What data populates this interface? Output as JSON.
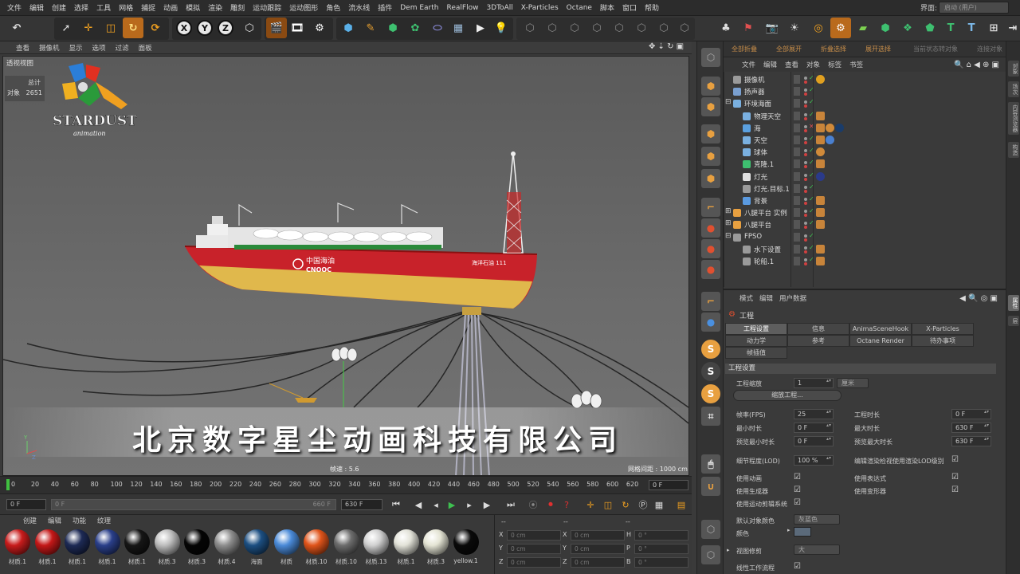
{
  "menubar": {
    "items": [
      "文件",
      "编辑",
      "创建",
      "选择",
      "工具",
      "网格",
      "捕捉",
      "动画",
      "模拟",
      "渲染",
      "雕刻",
      "运动跟踪",
      "运动图形",
      "角色",
      "流水线",
      "插件",
      "Dem Earth",
      "RealFlow",
      "3DToAll",
      "X-Particles",
      "Octane",
      "脚本",
      "窗口",
      "帮助"
    ],
    "layout_label": "界面:",
    "layout_value": "启动 (用户)"
  },
  "toolbar": {
    "xyz": [
      "X",
      "Y",
      "Z"
    ]
  },
  "viewport": {
    "menu": [
      "查看",
      "摄像机",
      "显示",
      "选项",
      "过滤",
      "面板"
    ],
    "label": "透视视图",
    "stat_title": "总计",
    "stat_obj_label": "对象",
    "stat_obj_value": "2651",
    "logo_text": "STARDUST",
    "logo_sub": "animation",
    "watermark": "北京数字星尘动画科技有限公司",
    "fps": "帧速 : 5.6",
    "grid_spacing": "网格间距 : 1000 cm",
    "ship_text_1": "中国海油",
    "ship_text_2": "CNOOC",
    "ship_text_3": "海洋石油 111"
  },
  "timeline": {
    "ticks": [
      "0",
      "20",
      "40",
      "60",
      "80",
      "100",
      "120",
      "140",
      "160",
      "180",
      "200",
      "220",
      "240",
      "260",
      "280",
      "300",
      "320",
      "340",
      "360",
      "380",
      "400",
      "420",
      "440",
      "460",
      "480",
      "500",
      "520",
      "540",
      "560",
      "580",
      "600",
      "620"
    ],
    "current_frame": "0 F"
  },
  "playbar": {
    "start": "0 F",
    "range_start": "0 F",
    "range_end": "660 F",
    "end": "630 F"
  },
  "materials": {
    "menu": [
      "创建",
      "编辑",
      "功能",
      "纹理"
    ],
    "items": [
      {
        "label": "材质.1",
        "color": "#c81c1c"
      },
      {
        "label": "材质.1",
        "color": "#c41818"
      },
      {
        "label": "材质.1",
        "color": "#1d2a55"
      },
      {
        "label": "材质.1",
        "color": "#2a3f8a"
      },
      {
        "label": "材质.1",
        "color": "#161616"
      },
      {
        "label": "材质.3",
        "color": "#bdbdbd"
      },
      {
        "label": "材质.3",
        "color": "#050505"
      },
      {
        "label": "材质.4",
        "color": "#8e8e8e"
      },
      {
        "label": "海面",
        "color": "#1c4f82"
      },
      {
        "label": "材质",
        "color": "#4a8ad8"
      },
      {
        "label": "材质.10",
        "color": "#e0541a"
      },
      {
        "label": "材质.10",
        "color": "#6d6d6d"
      },
      {
        "label": "材质.13",
        "color": "#d0d0d0"
      },
      {
        "label": "材质.1",
        "color": "#e2e2d8"
      },
      {
        "label": "材质.3",
        "color": "#e4e4d4"
      },
      {
        "label": "yellow.1",
        "color": "#0a0a0a"
      }
    ]
  },
  "coords": {
    "header": [
      "--",
      "--",
      "--"
    ],
    "rows": [
      {
        "a": "X",
        "av": "0 cm",
        "b": "X",
        "bv": "0 cm",
        "c": "H",
        "cv": "0 °"
      },
      {
        "a": "Y",
        "av": "0 cm",
        "b": "Y",
        "bv": "0 cm",
        "c": "P",
        "cv": "0 °"
      },
      {
        "a": "Z",
        "av": "0 cm",
        "b": "Z",
        "bv": "0 cm",
        "c": "B",
        "cv": "0 °"
      }
    ]
  },
  "object_manager": {
    "tabs": [
      "全部折叠",
      "全部展开",
      "折叠选择",
      "展开选择",
      "当前状态转对象",
      "连接对象"
    ],
    "menu": [
      "文件",
      "编辑",
      "查看",
      "对象",
      "标签",
      "书签"
    ],
    "rows": [
      {
        "name": "摄像机",
        "indent": 1
      },
      {
        "name": "扬声器",
        "indent": 1
      },
      {
        "name": "环境海面",
        "indent": 1
      },
      {
        "name": "物理天空",
        "indent": 2
      },
      {
        "name": "海",
        "indent": 2
      },
      {
        "name": "天空",
        "indent": 2
      },
      {
        "name": "球体",
        "indent": 2
      },
      {
        "name": "克隆.1",
        "indent": 2
      },
      {
        "name": "灯光",
        "indent": 2
      },
      {
        "name": "灯光.目标.1",
        "indent": 2
      },
      {
        "name": "背景",
        "indent": 2
      },
      {
        "name": "八腿平台 实例",
        "indent": 1
      },
      {
        "name": "八腿平台",
        "indent": 1
      },
      {
        "name": "FPSO",
        "indent": 1
      },
      {
        "name": "水下设置",
        "indent": 2
      },
      {
        "name": "轮船.1",
        "indent": 2
      }
    ]
  },
  "attributes": {
    "menu": [
      "模式",
      "编辑",
      "用户数据"
    ],
    "title": "工程",
    "tabs_row1": [
      "工程设置",
      "信息",
      "AnimaSceneHook",
      "X-Particles"
    ],
    "tabs_row2": [
      "动力学",
      "参考",
      "Octane Render",
      "待办事项"
    ],
    "tabs_row3": [
      "帧插值"
    ],
    "section": "工程设置",
    "scale_label": "工程缩放",
    "scale_value": "1",
    "scale_unit": "厘米",
    "scale_btn": "缩放工程...",
    "fps_label": "帧率(FPS)",
    "fps_value": "25",
    "proj_time_label": "工程时长",
    "proj_time_value": "0 F",
    "min_time_label": "最小时长",
    "min_time_value": "0 F",
    "max_time_label": "最大时长",
    "max_time_value": "630 F",
    "preview_min_label": "预览最小时长",
    "preview_min_value": "0 F",
    "preview_max_label": "预览最大时长",
    "preview_max_value": "630 F",
    "lod_label": "细节程度(LOD)",
    "lod_value": "100 %",
    "lod_render_label": "编辑渲染检视使用渲染LOD级别",
    "use_anim": "使用动画",
    "use_expr": "使用表达式",
    "use_gen": "使用生成器",
    "use_deform": "使用变形器",
    "use_motion": "使用运动剪辑系统",
    "def_color_label": "默认对象颜色",
    "def_color_value": "灰蓝色",
    "color_label": "颜色",
    "view_clip_label": "视图修剪",
    "view_clip_value": "大",
    "linear_label": "线性工作流程"
  },
  "side_tabs": [
    "对象",
    "场次",
    "内容浏览器",
    "构造",
    "属性",
    "层"
  ]
}
